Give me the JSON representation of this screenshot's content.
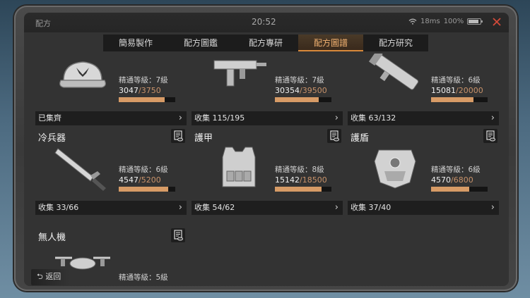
{
  "header": {
    "title": "配方",
    "time": "20:52",
    "ping": "18ms",
    "battery": "100%"
  },
  "tabs": [
    {
      "label": "簡易製作",
      "active": false
    },
    {
      "label": "配方圖鑑",
      "active": false
    },
    {
      "label": "配方專研",
      "active": false
    },
    {
      "label": "配方圖譜",
      "active": true
    },
    {
      "label": "配方研究",
      "active": false
    }
  ],
  "cards": [
    {
      "name": "",
      "level_text": "精通等級：7級",
      "current": "3047",
      "max": "/3750",
      "fraction": 0.81,
      "footer": "已集齊",
      "icon": "hat-icon"
    },
    {
      "name": "",
      "level_text": "精通等級：7級",
      "current": "30354",
      "max": "/39500",
      "fraction": 0.77,
      "footer": "收集 115/195",
      "icon": "smg-icon"
    },
    {
      "name": "",
      "level_text": "精通等級：6級",
      "current": "15081",
      "max": "/20000",
      "fraction": 0.75,
      "footer": "收集 63/132",
      "icon": "launcher-icon"
    },
    {
      "name": "冷兵器",
      "level_text": "精通等級：6級",
      "current": "4547",
      "max": "/5200",
      "fraction": 0.87,
      "footer": "收集 33/66",
      "icon": "blade-icon"
    },
    {
      "name": "護甲",
      "level_text": "精通等級：8級",
      "current": "15142",
      "max": "/18500",
      "fraction": 0.82,
      "footer": "收集 54/62",
      "icon": "vest-icon"
    },
    {
      "name": "護盾",
      "level_text": "精通等級：6級",
      "current": "4570",
      "max": "/6800",
      "fraction": 0.67,
      "footer": "收集 37/40",
      "icon": "shield-icon"
    },
    {
      "name": "無人機",
      "level_text": "精通等級：5級",
      "current": "",
      "max": "",
      "fraction": 0,
      "footer": "",
      "icon": "drone-icon"
    }
  ],
  "back_label": "返回"
}
